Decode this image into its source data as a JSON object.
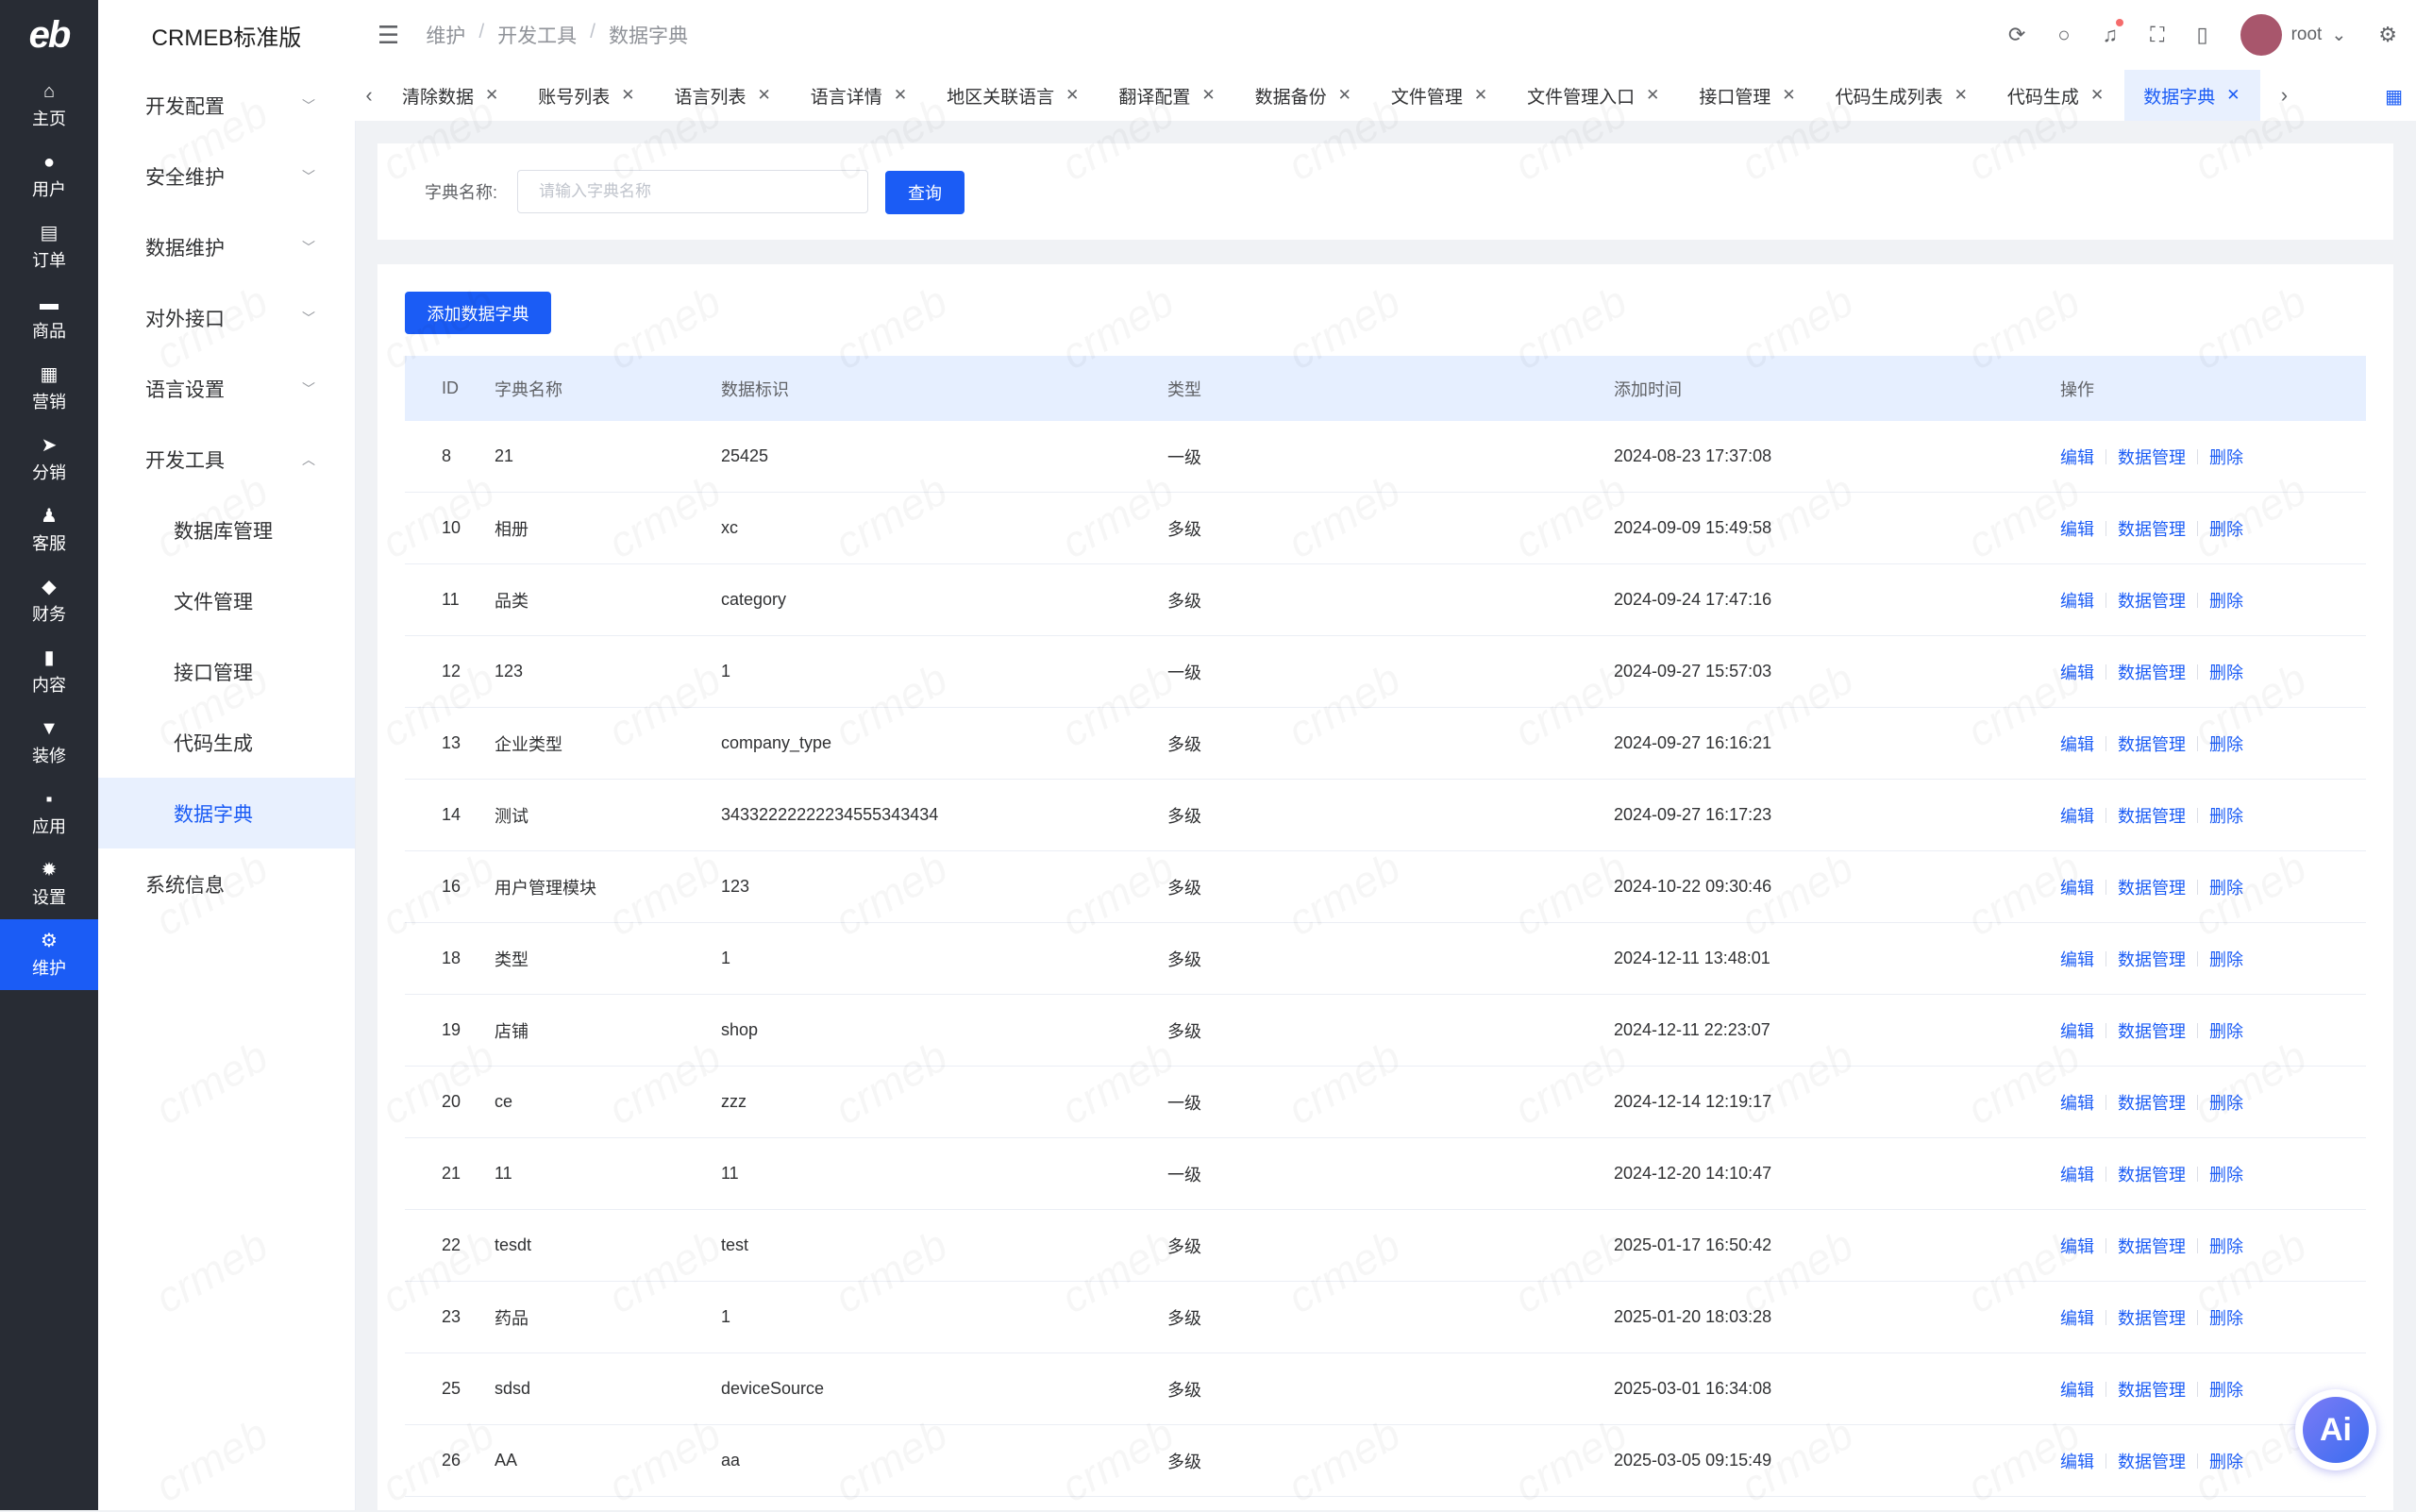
{
  "app": {
    "logo": "eb",
    "name": "CRMEB标准版"
  },
  "rail": [
    {
      "label": "主页",
      "icon": "home-icon",
      "glyph": "⌂"
    },
    {
      "label": "用户",
      "icon": "user-icon",
      "glyph": "●"
    },
    {
      "label": "订单",
      "icon": "order-icon",
      "glyph": "▤"
    },
    {
      "label": "商品",
      "icon": "product-icon",
      "glyph": "▬"
    },
    {
      "label": "营销",
      "icon": "marketing-icon",
      "glyph": "▦"
    },
    {
      "label": "分销",
      "icon": "distribution-icon",
      "glyph": "➤"
    },
    {
      "label": "客服",
      "icon": "service-icon",
      "glyph": "♟"
    },
    {
      "label": "财务",
      "icon": "finance-icon",
      "glyph": "◆"
    },
    {
      "label": "内容",
      "icon": "content-icon",
      "glyph": "▮"
    },
    {
      "label": "装修",
      "icon": "decoration-icon",
      "glyph": "▼"
    },
    {
      "label": "应用",
      "icon": "apps-icon",
      "glyph": "▪"
    },
    {
      "label": "设置",
      "icon": "settings-icon",
      "glyph": "✹"
    },
    {
      "label": "维护",
      "icon": "maintenance-icon",
      "glyph": "⚙"
    }
  ],
  "submenu": {
    "groups": [
      {
        "label": "开发配置",
        "expanded": false
      },
      {
        "label": "安全维护",
        "expanded": false
      },
      {
        "label": "数据维护",
        "expanded": false
      },
      {
        "label": "对外接口",
        "expanded": false
      },
      {
        "label": "语言设置",
        "expanded": false
      },
      {
        "label": "开发工具",
        "expanded": true
      }
    ],
    "children": [
      "数据库管理",
      "文件管理",
      "接口管理",
      "代码生成",
      "数据字典"
    ],
    "footer": "系统信息"
  },
  "breadcrumb": [
    "维护",
    "开发工具",
    "数据字典"
  ],
  "header": {
    "user": "root"
  },
  "tabs": [
    "清除数据",
    "账号列表",
    "语言列表",
    "语言详情",
    "地区关联语言",
    "翻译配置",
    "数据备份",
    "文件管理",
    "文件管理入口",
    "接口管理",
    "代码生成列表",
    "代码生成",
    "数据字典"
  ],
  "search": {
    "label": "字典名称:",
    "placeholder": "请输入字典名称",
    "value": "",
    "query_label": "查询"
  },
  "add_label": "添加数据字典",
  "table": {
    "headers": [
      "ID",
      "字典名称",
      "数据标识",
      "类型",
      "添加时间",
      "操作"
    ],
    "actions": [
      "编辑",
      "数据管理",
      "删除"
    ],
    "rows": [
      {
        "id": "8",
        "name": "21",
        "key": "25425",
        "type": "一级",
        "time": "2024-08-23 17:37:08"
      },
      {
        "id": "10",
        "name": "相册",
        "key": "xc",
        "type": "多级",
        "time": "2024-09-09 15:49:58"
      },
      {
        "id": "11",
        "name": "品类",
        "key": "category",
        "type": "多级",
        "time": "2024-09-24 17:47:16"
      },
      {
        "id": "12",
        "name": "123",
        "key": "1",
        "type": "一级",
        "time": "2024-09-27 15:57:03"
      },
      {
        "id": "13",
        "name": "企业类型",
        "key": "company_type",
        "type": "多级",
        "time": "2024-09-27 16:16:21"
      },
      {
        "id": "14",
        "name": "测试",
        "key": "34332222222234555343434",
        "type": "多级",
        "time": "2024-09-27 16:17:23"
      },
      {
        "id": "16",
        "name": "用户管理模块",
        "key": "123",
        "type": "多级",
        "time": "2024-10-22 09:30:46"
      },
      {
        "id": "18",
        "name": "类型",
        "key": "1",
        "type": "多级",
        "time": "2024-12-11 13:48:01"
      },
      {
        "id": "19",
        "name": "店铺",
        "key": "shop",
        "type": "多级",
        "time": "2024-12-11 22:23:07"
      },
      {
        "id": "20",
        "name": "ce",
        "key": "zzz",
        "type": "一级",
        "time": "2024-12-14 12:19:17"
      },
      {
        "id": "21",
        "name": "11",
        "key": "11",
        "type": "一级",
        "time": "2024-12-20 14:10:47"
      },
      {
        "id": "22",
        "name": "tesdt",
        "key": "test",
        "type": "多级",
        "time": "2025-01-17 16:50:42"
      },
      {
        "id": "23",
        "name": "药品",
        "key": "1",
        "type": "多级",
        "time": "2025-01-20 18:03:28"
      },
      {
        "id": "25",
        "name": "sdsd",
        "key": "deviceSource",
        "type": "多级",
        "time": "2025-03-01 16:34:08"
      },
      {
        "id": "26",
        "name": "AA",
        "key": "aa",
        "type": "多级",
        "time": "2025-03-05 09:15:49"
      }
    ]
  },
  "watermark": "crmeb",
  "ai_badge": "Ai",
  "colors": {
    "primary": "#1b5cf5",
    "rail": "#282c34",
    "header_row": "#e6efff"
  }
}
